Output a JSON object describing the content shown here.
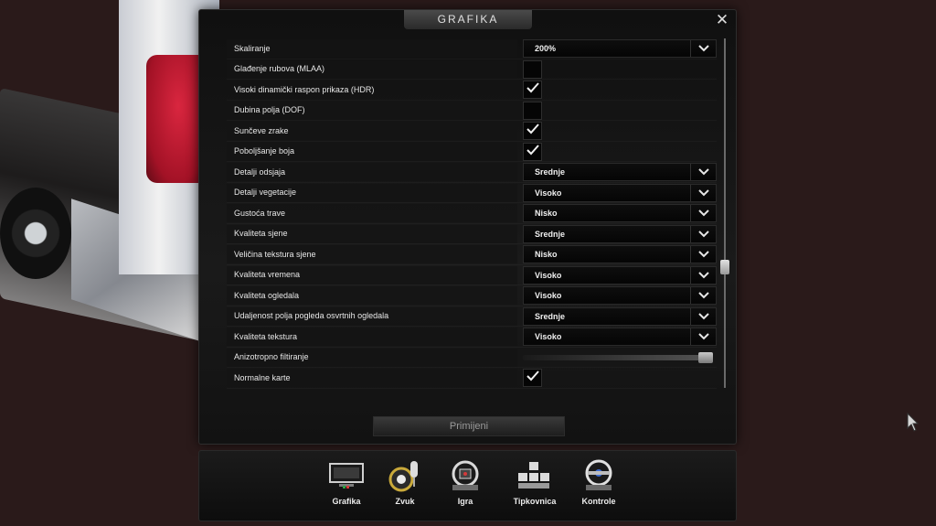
{
  "window": {
    "title": "GRAFIKA",
    "close_glyph": "✕"
  },
  "settings": [
    {
      "label": "Skaliranje",
      "type": "dropdown",
      "value": "200%"
    },
    {
      "label": "Glađenje rubova (MLAA)",
      "type": "checkbox",
      "checked": false
    },
    {
      "label": "Visoki dinamički raspon prikaza (HDR)",
      "type": "checkbox",
      "checked": true
    },
    {
      "label": "Dubina polja (DOF)",
      "type": "checkbox",
      "checked": false
    },
    {
      "label": "Sunčeve zrake",
      "type": "checkbox",
      "checked": true
    },
    {
      "label": "Poboljšanje boja",
      "type": "checkbox",
      "checked": true
    },
    {
      "label": "Detalji odsjaja",
      "type": "dropdown",
      "value": "Srednje"
    },
    {
      "label": "Detalji vegetacije",
      "type": "dropdown",
      "value": "Visoko"
    },
    {
      "label": "Gustoća trave",
      "type": "dropdown",
      "value": "Nisko"
    },
    {
      "label": "Kvaliteta sjene",
      "type": "dropdown",
      "value": "Srednje"
    },
    {
      "label": "Veličina tekstura sjene",
      "type": "dropdown",
      "value": "Nisko"
    },
    {
      "label": "Kvaliteta vremena",
      "type": "dropdown",
      "value": "Visoko"
    },
    {
      "label": "Kvaliteta ogledala",
      "type": "dropdown",
      "value": "Visoko"
    },
    {
      "label": "Udaljenost  polja pogleda osvrtnih ogledala",
      "type": "dropdown",
      "value": "Srednje"
    },
    {
      "label": "Kvaliteta tekstura",
      "type": "dropdown",
      "value": "Visoko"
    },
    {
      "label": "Anizotropno filtiranje",
      "type": "slider",
      "value": 1.0
    },
    {
      "label": "Normalne karte",
      "type": "checkbox",
      "checked": true
    }
  ],
  "scroll_position": 0.66,
  "apply_button": {
    "label": "Primijeni"
  },
  "nav": [
    {
      "id": "grafika",
      "label": "Grafika",
      "icon": "monitor-icon"
    },
    {
      "id": "zvuk",
      "label": "Zvuk",
      "icon": "speaker-icon"
    },
    {
      "id": "igra",
      "label": "Igra",
      "icon": "steering-wheel-icon"
    },
    {
      "id": "tipkovnica",
      "label": "Tipkovnica",
      "icon": "keyboard-icon"
    },
    {
      "id": "kontrole",
      "label": "Kontrole",
      "icon": "controller-wheel-icon"
    }
  ],
  "colors": {
    "background": "#2a1a1a",
    "panel": "#111111",
    "text": "#e8e8e8",
    "apply_text": "#9a9a9a"
  }
}
